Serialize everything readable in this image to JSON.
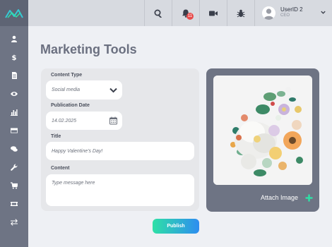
{
  "sidebar": {
    "logo": "logo-mark",
    "items": [
      {
        "name": "sidebar-item-user",
        "icon": "user-icon"
      },
      {
        "name": "sidebar-item-dollar",
        "icon": "dollar-icon"
      },
      {
        "name": "sidebar-item-document",
        "icon": "document-icon"
      },
      {
        "name": "sidebar-item-eye",
        "icon": "eye-icon"
      },
      {
        "name": "sidebar-item-chart",
        "icon": "bar-chart-icon"
      },
      {
        "name": "sidebar-item-card",
        "icon": "credit-card-icon"
      },
      {
        "name": "sidebar-item-chat",
        "icon": "chat-icon"
      },
      {
        "name": "sidebar-item-tools",
        "icon": "wrench-icon"
      },
      {
        "name": "sidebar-item-cart",
        "icon": "cart-icon"
      },
      {
        "name": "sidebar-item-ticket",
        "icon": "ticket-icon"
      },
      {
        "name": "sidebar-item-transfer",
        "icon": "transfer-icon"
      }
    ]
  },
  "topbar": {
    "notification_count": "11",
    "user_name": "UserID 2",
    "user_role": "CEO"
  },
  "page": {
    "title": "Marketing Tools"
  },
  "form": {
    "content_type_label": "Content Type",
    "content_type_value": "Social media",
    "publication_date_label": "Publication Date",
    "publication_date_value": "14.02.2025",
    "title_label": "Title",
    "title_value": "Happy Valentine's Day!",
    "content_label": "Content",
    "content_placeholder": "Type message here"
  },
  "image_panel": {
    "attach_label": "Attach Image"
  },
  "publish_label": "Publish",
  "colors": {
    "sidebar": "#6e7484",
    "topbar": "#d7dae0",
    "accent_green": "#2ee0a6",
    "accent_blue": "#2d8df0",
    "badge": "#e74c4c"
  }
}
